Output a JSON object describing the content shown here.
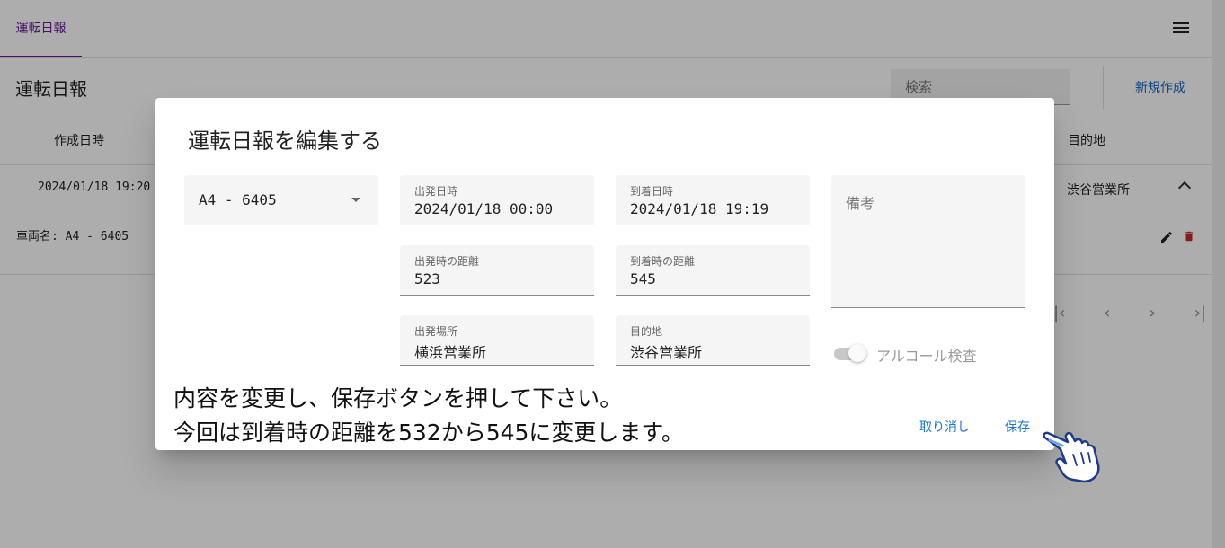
{
  "tabs": {
    "active": "運転日報"
  },
  "header": {
    "title": "運転日報",
    "search_placeholder": "検索",
    "new_label": "新規作成"
  },
  "table": {
    "headers": {
      "created": "作成日時",
      "destination": "目的地"
    },
    "row": {
      "created": "2024/01/18 19:20",
      "destination": "渋谷営業所"
    },
    "detail": "車両名: A4 - 6405"
  },
  "pager": {
    "first": "|‹",
    "prev": "‹",
    "next": "›",
    "last": "›|"
  },
  "dialog": {
    "title": "運転日報を編集する",
    "vehicle": "A4 - 6405",
    "departure_time": {
      "label": "出発日時",
      "value": "2024/01/18 00:00"
    },
    "arrival_time": {
      "label": "到着日時",
      "value": "2024/01/18 19:19"
    },
    "departure_distance": {
      "label": "出発時の距離",
      "value": "523"
    },
    "arrival_distance": {
      "label": "到着時の距離",
      "value": "545"
    },
    "departure_place": {
      "label": "出発場所",
      "value": "横浜営業所"
    },
    "destination": {
      "label": "目的地",
      "value": "渋谷営業所"
    },
    "notes_placeholder": "備考",
    "alcohol_label": "アルコール検査",
    "alcohol_checked": true,
    "instructions_line1": "内容を変更し、保存ボタンを押して下さい。",
    "instructions_line2": "今回は到着時の距離を532から545に変更します。",
    "cancel_label": "取り消し",
    "save_label": "保存"
  },
  "colors": {
    "accent": "#6a1b9a",
    "link": "#1976d2",
    "delete": "#c62828"
  }
}
